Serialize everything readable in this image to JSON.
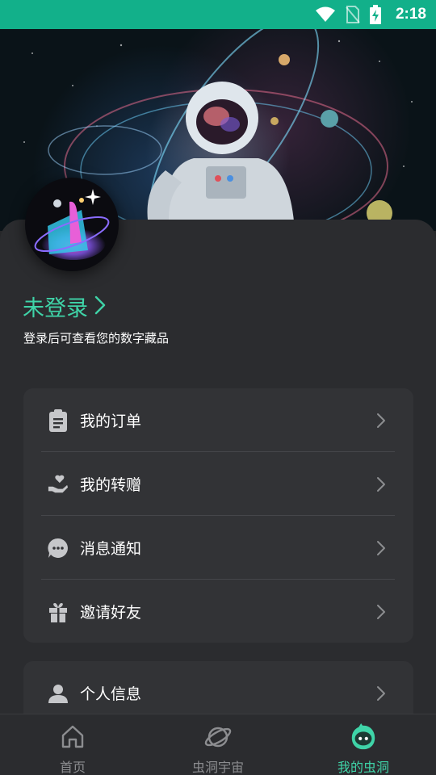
{
  "status_bar": {
    "time": "2:18",
    "icons": [
      "wifi-icon",
      "no-sim-icon",
      "battery-charging-icon"
    ],
    "background": "#12b08a"
  },
  "profile": {
    "login_title": "未登录",
    "login_subtitle": "登录后可查看您的数字藏品",
    "accent_color": "#3fd4a8"
  },
  "menu_group_1": {
    "items": [
      {
        "label": "我的订单",
        "icon": "clipboard-icon"
      },
      {
        "label": "我的转赠",
        "icon": "heart-hand-icon"
      },
      {
        "label": "消息通知",
        "icon": "chat-bubble-icon"
      },
      {
        "label": "邀请好友",
        "icon": "gift-icon"
      }
    ]
  },
  "menu_group_2": {
    "items": [
      {
        "label": "个人信息",
        "icon": "person-icon"
      }
    ]
  },
  "bottom_nav": {
    "items": [
      {
        "label": "首页",
        "icon": "home-icon",
        "active": false
      },
      {
        "label": "虫洞宇宙",
        "icon": "planet-icon",
        "active": false
      },
      {
        "label": "我的虫洞",
        "icon": "wormhole-mascot-icon",
        "active": true
      }
    ]
  }
}
